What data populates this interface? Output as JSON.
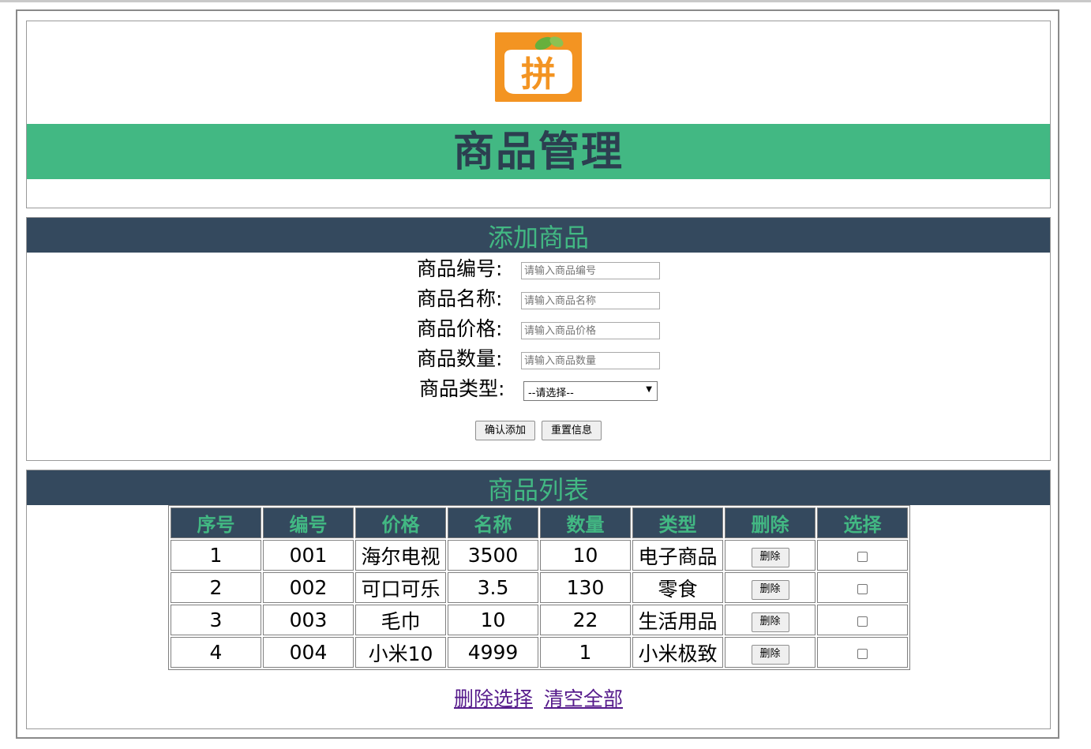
{
  "header": {
    "title": "商品管理",
    "logo_glyph": "拼"
  },
  "add": {
    "title": "添加商品",
    "fields": [
      {
        "label": "商品编号:",
        "placeholder": "请输入商品编号"
      },
      {
        "label": "商品名称:",
        "placeholder": "请输入商品名称"
      },
      {
        "label": "商品价格:",
        "placeholder": "请输入商品价格"
      },
      {
        "label": "商品数量:",
        "placeholder": "请输入商品数量"
      }
    ],
    "type_label": "商品类型:",
    "type_selected": "--请选择--",
    "confirm_label": "确认添加",
    "reset_label": "重置信息"
  },
  "list": {
    "title": "商品列表",
    "columns": [
      "序号",
      "编号",
      "价格",
      "名称",
      "数量",
      "类型",
      "删除",
      "选择"
    ],
    "rows": [
      {
        "index": "1",
        "code": "001",
        "price": "海尔电视",
        "name": "3500",
        "qty": "10",
        "type": "电子商品"
      },
      {
        "index": "2",
        "code": "002",
        "price": "可口可乐",
        "name": "3.5",
        "qty": "130",
        "type": "零食"
      },
      {
        "index": "3",
        "code": "003",
        "price": "毛巾",
        "name": "10",
        "qty": "22",
        "type": "生活用品"
      },
      {
        "index": "4",
        "code": "004",
        "price": "小米10",
        "name": "4999",
        "qty": "1",
        "type": "小米极致"
      }
    ],
    "delete_label": "删除",
    "delete_selected_label": "删除选择",
    "clear_all_label": "清空全部"
  },
  "colors": {
    "accent": "#42b883",
    "dark": "#34495e",
    "logo": "#f39422"
  }
}
